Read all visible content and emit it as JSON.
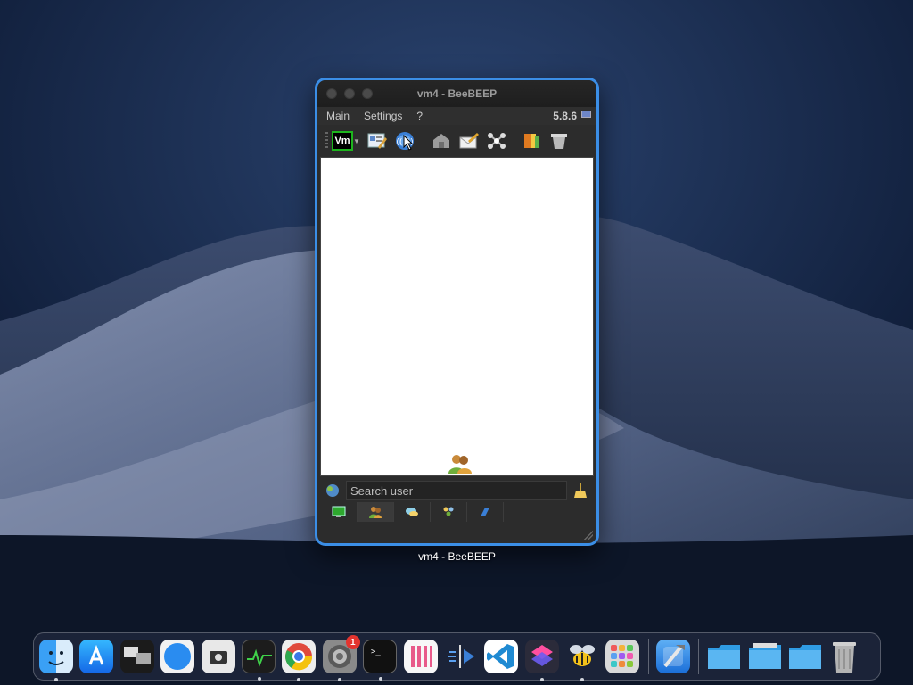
{
  "window": {
    "title": "vm4 - BeeBEEP",
    "label": "vm4 - BeeBEEP",
    "version": "5.8.6",
    "accent_color": "#3b8ee6"
  },
  "menubar": {
    "items": [
      "Main",
      "Settings",
      "?"
    ]
  },
  "toolbar": {
    "status_badge": "Vm",
    "buttons": [
      {
        "icon": "edit-profile-icon"
      },
      {
        "icon": "network-broadcast-icon"
      },
      {
        "icon": "home-icon"
      },
      {
        "icon": "compose-message-icon"
      },
      {
        "icon": "network-graph-icon"
      },
      {
        "icon": "book-icon"
      },
      {
        "icon": "trash-icon"
      }
    ]
  },
  "search": {
    "placeholder": "Search user"
  },
  "tabs": [
    {
      "icon": "screen-icon"
    },
    {
      "icon": "users-icon"
    },
    {
      "icon": "chat-icon"
    },
    {
      "icon": "groups-icon"
    },
    {
      "icon": "file-share-icon"
    }
  ],
  "dock": {
    "apps": [
      {
        "name": "finder-icon",
        "running": true
      },
      {
        "name": "app-store-icon",
        "running": false
      },
      {
        "name": "screen-sharing-icon",
        "running": false
      },
      {
        "name": "safari-icon",
        "running": false
      },
      {
        "name": "screenshot-icon",
        "running": false
      },
      {
        "name": "activity-monitor-icon",
        "running": true
      },
      {
        "name": "chrome-icon",
        "running": true
      },
      {
        "name": "system-preferences-icon",
        "running": true,
        "badge": "1"
      },
      {
        "name": "terminal-icon",
        "running": true
      },
      {
        "name": "columns-app-icon",
        "running": false
      },
      {
        "name": "instruments-icon",
        "running": false
      },
      {
        "name": "vscode-icon",
        "running": false
      },
      {
        "name": "shortcuts-icon",
        "running": true
      },
      {
        "name": "beebeep-icon",
        "running": true
      },
      {
        "name": "launchpad-icon",
        "running": false
      },
      {
        "name": "xcode-icon",
        "running": false
      }
    ]
  }
}
